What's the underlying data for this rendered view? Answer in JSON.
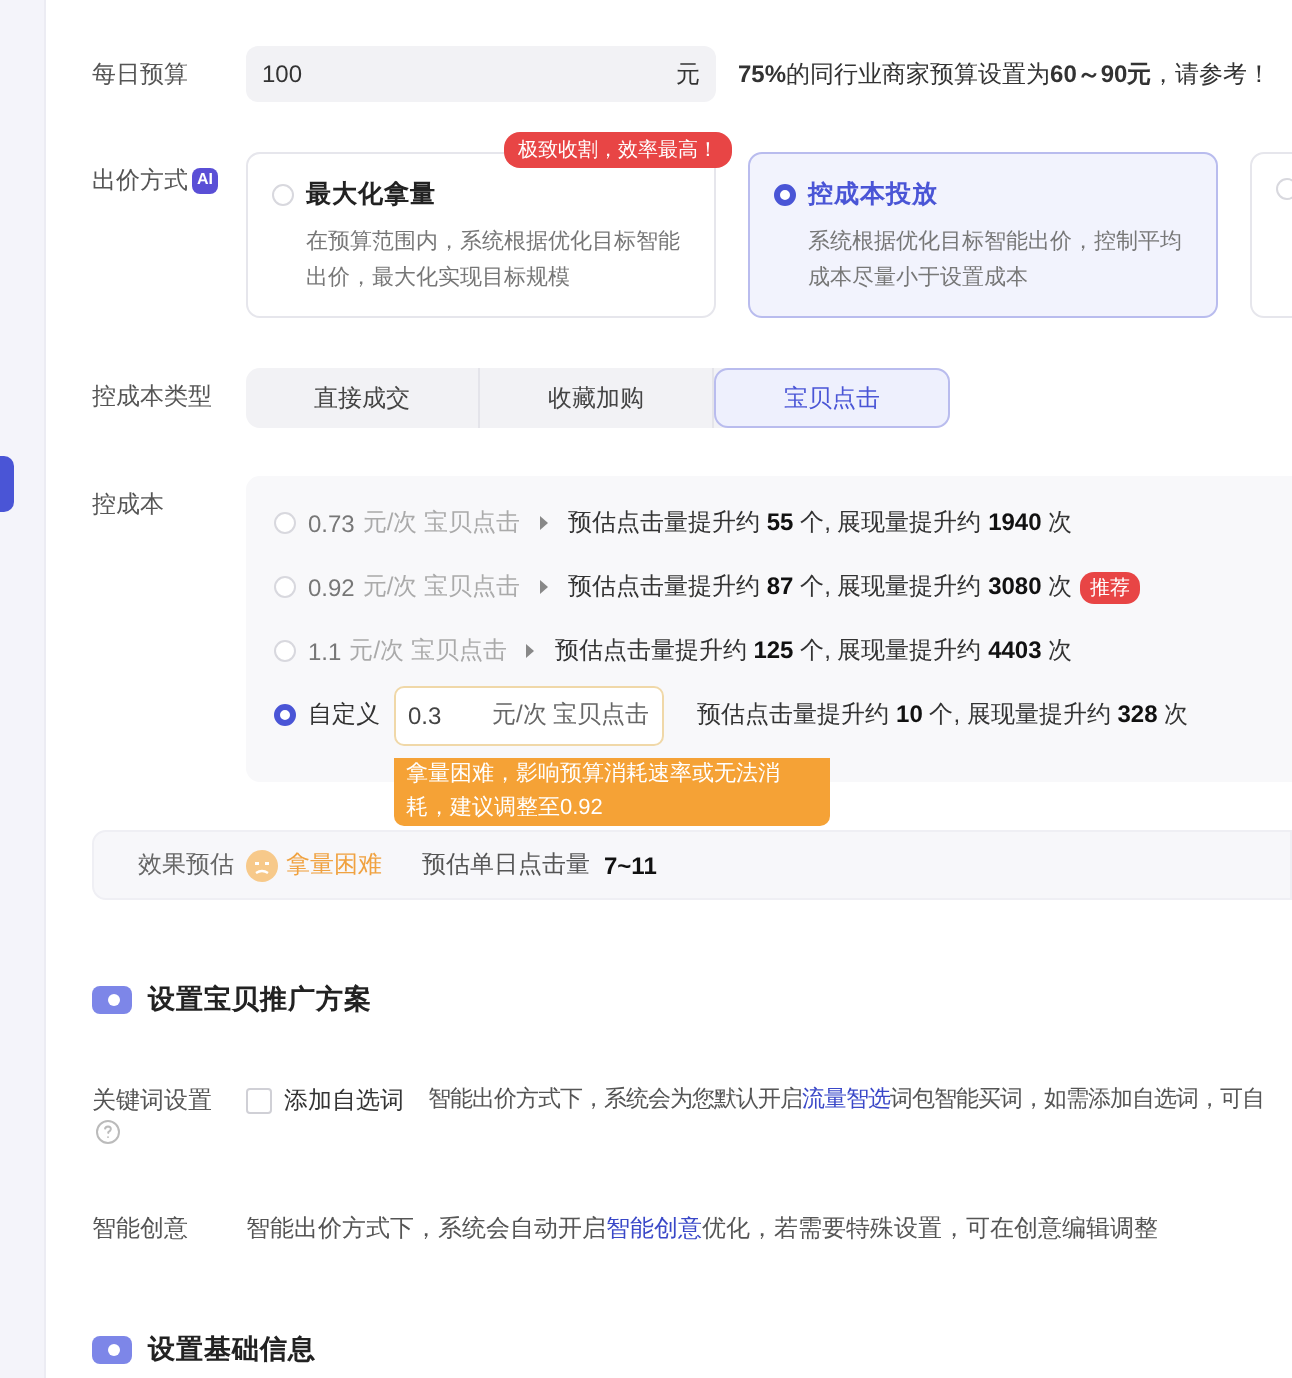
{
  "sidebar": {
    "tab_selected": true
  },
  "budget": {
    "label": "每日预算",
    "value": "100",
    "unit": "元",
    "hint": "**75%**的同行业商家预算设置为**60～90元**，请参考！"
  },
  "bid_method": {
    "label": "出价方式",
    "ai_badge": "AI",
    "cards": [
      {
        "title": "最大化拿量",
        "desc": "在预算范围内，系统根据优化目标智能出价，最大化实现目标规模",
        "badge": "极致收割，效率最高！",
        "selected": false
      },
      {
        "title": "控成本投放",
        "desc": "系统根据优化目标智能出价，控制平均成本尽量小于设置成本",
        "selected": true
      },
      {
        "selected": false
      }
    ]
  },
  "cost_type": {
    "label": "控成本类型",
    "segments": [
      {
        "label": "直接成交",
        "selected": false
      },
      {
        "label": "收藏加购",
        "selected": false
      },
      {
        "label": "宝贝点击",
        "selected": true
      }
    ]
  },
  "cost": {
    "label": "控成本",
    "options": [
      {
        "kind": "preset",
        "price": "0.73",
        "unit": "元/次 宝贝点击",
        "estimate": "预估点击量提升约 **55** 个, 展现量提升约 **1940** 次",
        "selected": false
      },
      {
        "kind": "preset",
        "price": "0.92",
        "unit": "元/次 宝贝点击",
        "estimate": "预估点击量提升约 **87** 个, 展现量提升约 **3080** 次",
        "tag": "推荐",
        "selected": false
      },
      {
        "kind": "preset",
        "price": "1.1",
        "unit": "元/次 宝贝点击",
        "estimate": "预估点击量提升约 **125** 个, 展现量提升约 **4403** 次",
        "selected": false
      },
      {
        "kind": "custom",
        "label": "自定义",
        "value": "0.3",
        "unit": "元/次 宝贝点击",
        "estimate": "预估点击量提升约 **10** 个, 展现量提升约 **328** 次",
        "selected": true
      }
    ],
    "tooltip": "拿量困难，影响预算消耗速率或无法消耗，建议调整至0.92"
  },
  "effect": {
    "label": "效果预估",
    "status": "拿量困难",
    "metric_label": "预估单日点击量",
    "metric_value": "7~11"
  },
  "section_plan": {
    "title": "设置宝贝推广方案"
  },
  "keywords": {
    "label": "关键词设置",
    "checkbox": {
      "label": "添加自选词",
      "checked": false
    },
    "before": "智能出价方式下，系统会为您默认开启",
    "link": "流量智选",
    "after": "词包智能买词，如需添加自选词，可自"
  },
  "creative": {
    "label": "智能创意",
    "before": "智能出价方式下，系统会自动开启",
    "link": "智能创意",
    "after": "优化，若需要特殊设置，可在创意编辑调整"
  },
  "section_basic": {
    "title": "设置基础信息"
  }
}
